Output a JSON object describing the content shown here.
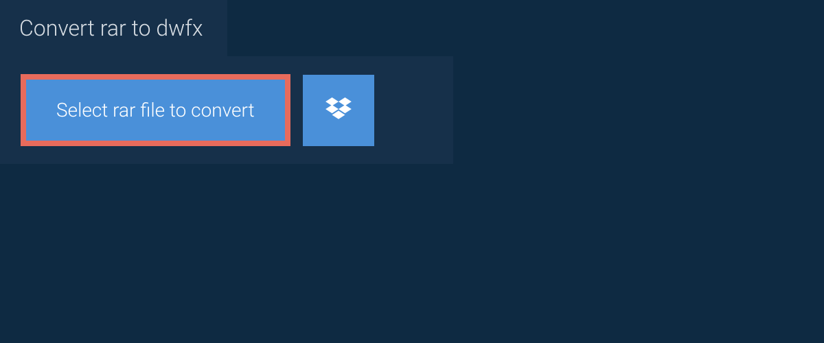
{
  "header": {
    "tab_label": "Convert rar to dwfx"
  },
  "actions": {
    "select_button_label": "Select rar file to convert",
    "dropbox_icon_name": "dropbox-icon"
  },
  "colors": {
    "page_bg": "#0e2a42",
    "panel_bg": "#16304a",
    "button_bg": "#4a90d9",
    "button_border": "#e86b5c",
    "text_light": "#d8dee4",
    "text_white": "#ffffff"
  }
}
